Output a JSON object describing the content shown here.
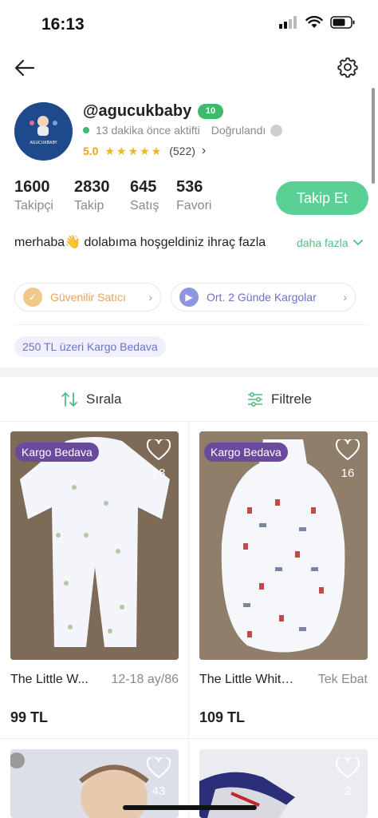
{
  "status_bar": {
    "time": "16:13"
  },
  "profile": {
    "username": "@agucukbaby",
    "level": "10",
    "active_text": "13 dakika önce aktifti",
    "verified_text": "Doğrulandı",
    "rating_value": "5.0",
    "rating_stars": "★★★★★",
    "rating_count": "(522)",
    "avatar_brand": "AGUCUKBABY"
  },
  "stats": [
    {
      "value": "1600",
      "label": "Takipçi"
    },
    {
      "value": "2830",
      "label": "Takip"
    },
    {
      "value": "645",
      "label": "Satış"
    },
    {
      "value": "536",
      "label": "Favori"
    }
  ],
  "follow_button": "Takip Et",
  "bio": {
    "text": "merhaba👋 dolabıma hoşgeldiniz ihraç fazla",
    "more": "daha fazla"
  },
  "chips": {
    "trusted": "Güvenilir Satıcı",
    "shipping": "Ort. 2 Günde Kargolar"
  },
  "cargo_tag": "250 TL üzeri Kargo Bedava",
  "toolbar": {
    "sort": "Sırala",
    "filter": "Filtrele"
  },
  "products": [
    {
      "badge": "Kargo Bedava",
      "likes": "28",
      "title": "The Little W...",
      "size": "12-18 ay/86",
      "price": "99 TL"
    },
    {
      "badge": "Kargo Bedava",
      "likes": "16",
      "title": "The Little White...",
      "size": "Tek Ebat",
      "price": "109 TL"
    },
    {
      "likes": "43"
    },
    {
      "likes": "2"
    }
  ],
  "colors": {
    "accent": "#5ad094",
    "badge": "#6a4a9c",
    "star": "#f2b51e"
  }
}
